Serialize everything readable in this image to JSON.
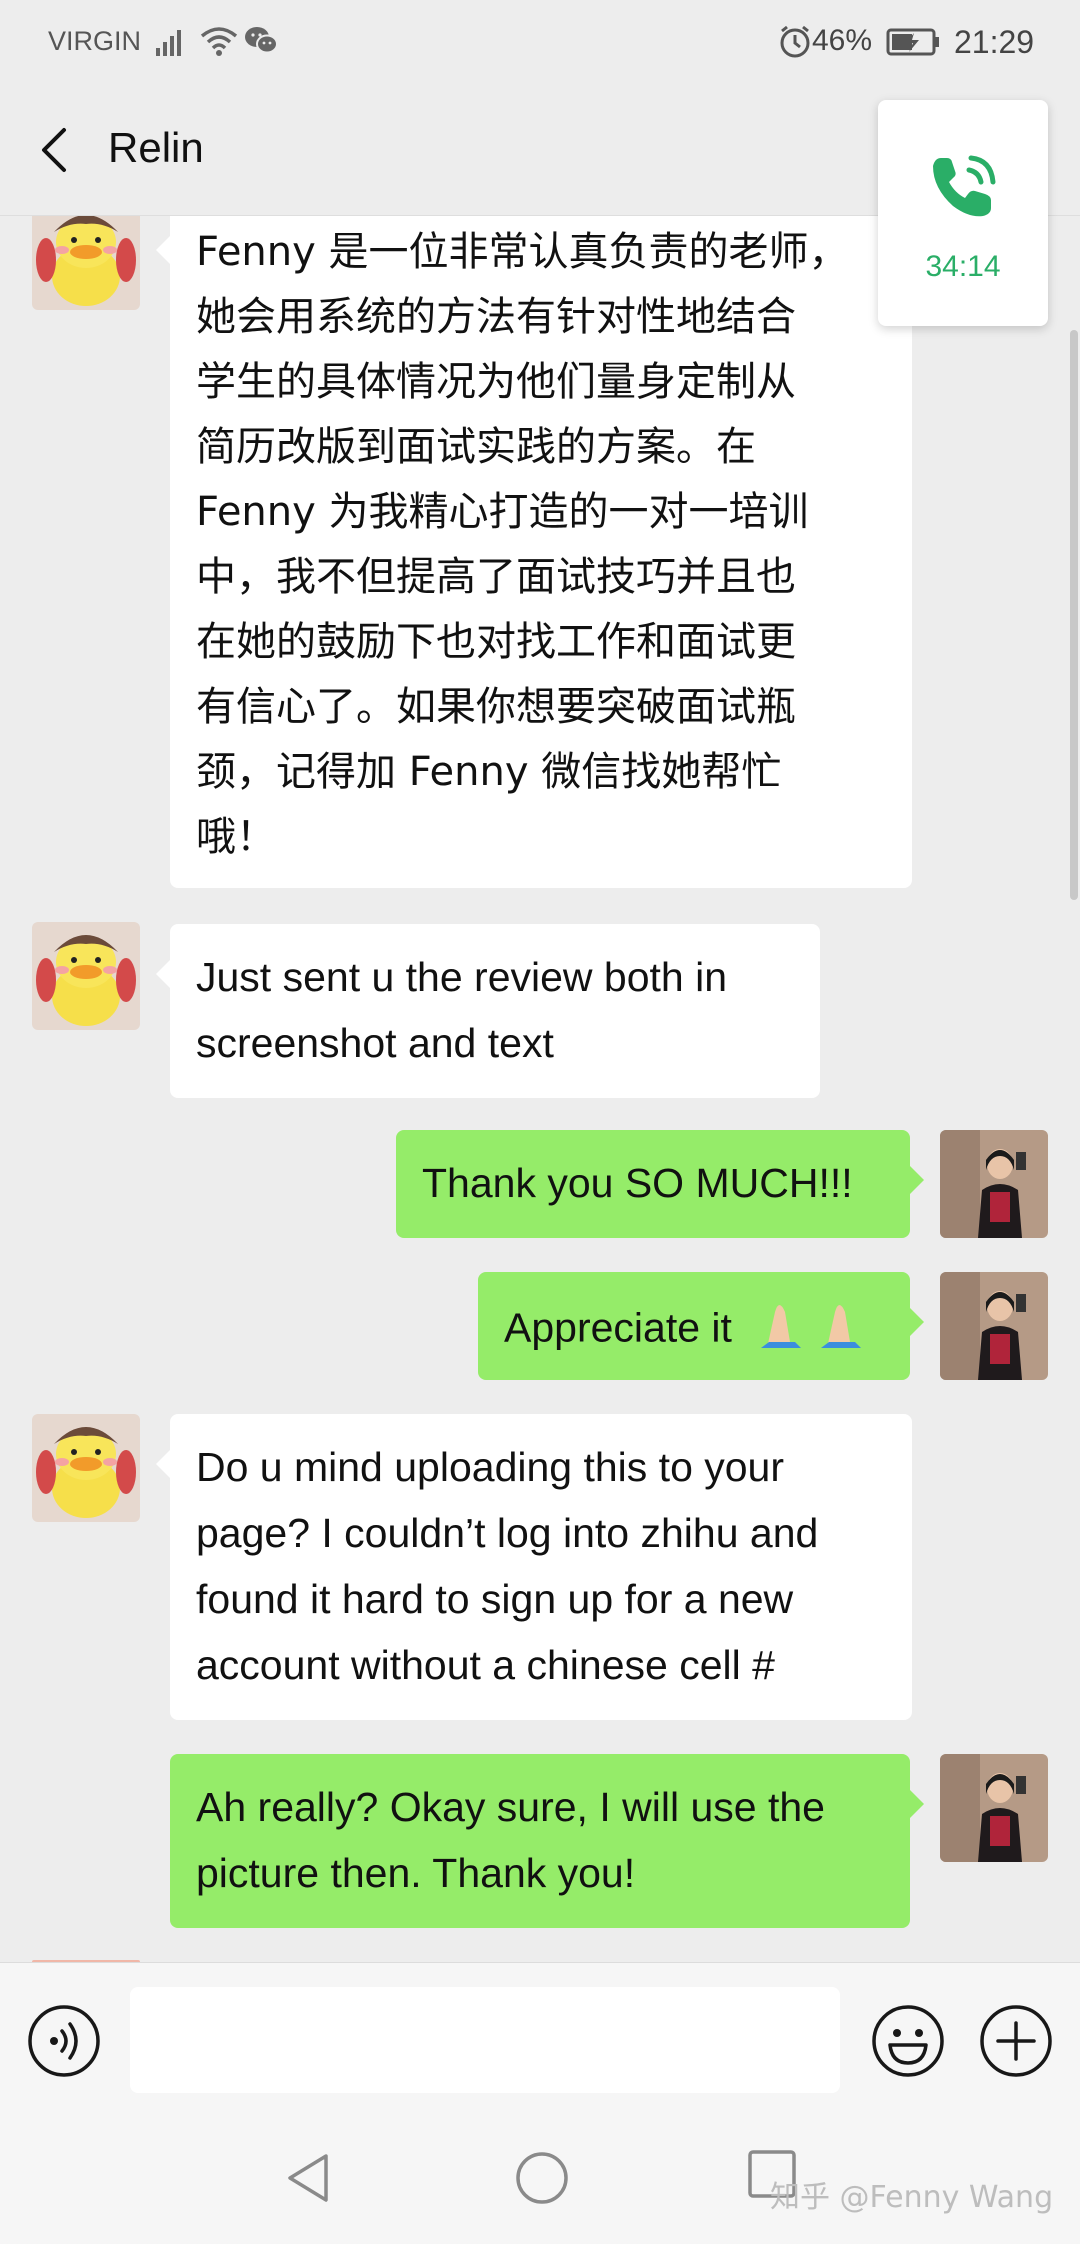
{
  "status_bar": {
    "carrier": "VIRGIN",
    "battery_percent": "46%",
    "time": "21:29",
    "icons": [
      "signal-icon",
      "wifi-icon",
      "wechat-icon",
      "alarm-icon",
      "battery-icon"
    ]
  },
  "header": {
    "title": "Relin",
    "back_icon": "chevron-left-icon"
  },
  "call": {
    "duration": "34:14",
    "icon": "phone-icon",
    "color": "#2aae67"
  },
  "messages": [
    {
      "sender": "Relin",
      "side": "in",
      "lines": [
        "Fenny 是一位非常认真负责的老师，",
        "她会用系统的方法有针对性地结合",
        "学生的具体情况为他们量身定制从",
        "简历改版到面试实践的方案。在",
        "Fenny 为我精心打造的一对一培训",
        "中，我不但提高了面试技巧并且也",
        "在她的鼓励下也对找工作和面试更",
        "有信心了。如果你想要突破面试瓶",
        "颈，记得加 Fenny 微信找她帮忙",
        "哦！"
      ]
    },
    {
      "sender": "Relin",
      "side": "in",
      "lines": [
        "Just sent u the review both in",
        "screenshot and text"
      ]
    },
    {
      "sender": "me",
      "side": "out",
      "lines": [
        "Thank you SO MUCH!!!"
      ]
    },
    {
      "sender": "me",
      "side": "out",
      "lines": [
        "Appreciate it"
      ],
      "emoji": "folded-hands-icon"
    },
    {
      "sender": "Relin",
      "side": "in",
      "lines": [
        "Do u mind uploading this to your",
        "page? I couldn’t log into zhihu and",
        "found it hard to sign up for a new",
        "account without a chinese cell #"
      ]
    },
    {
      "sender": "me",
      "side": "out",
      "lines": [
        "Ah really? Okay sure, I will use the",
        "picture then. Thank you!"
      ]
    }
  ],
  "input_bar": {
    "voice_icon": "voice-input-icon",
    "text_value": "",
    "emoji_icon": "emoji-icon",
    "plus_icon": "plus-icon"
  },
  "nav_bar": {
    "icons": [
      "nav-back-icon",
      "nav-home-icon",
      "nav-recents-icon"
    ],
    "watermark": "知乎 @Fenny Wang"
  },
  "colors": {
    "background": "#ededed",
    "outgoing_bubble": "#95ec69",
    "incoming_bubble": "#ffffff"
  }
}
